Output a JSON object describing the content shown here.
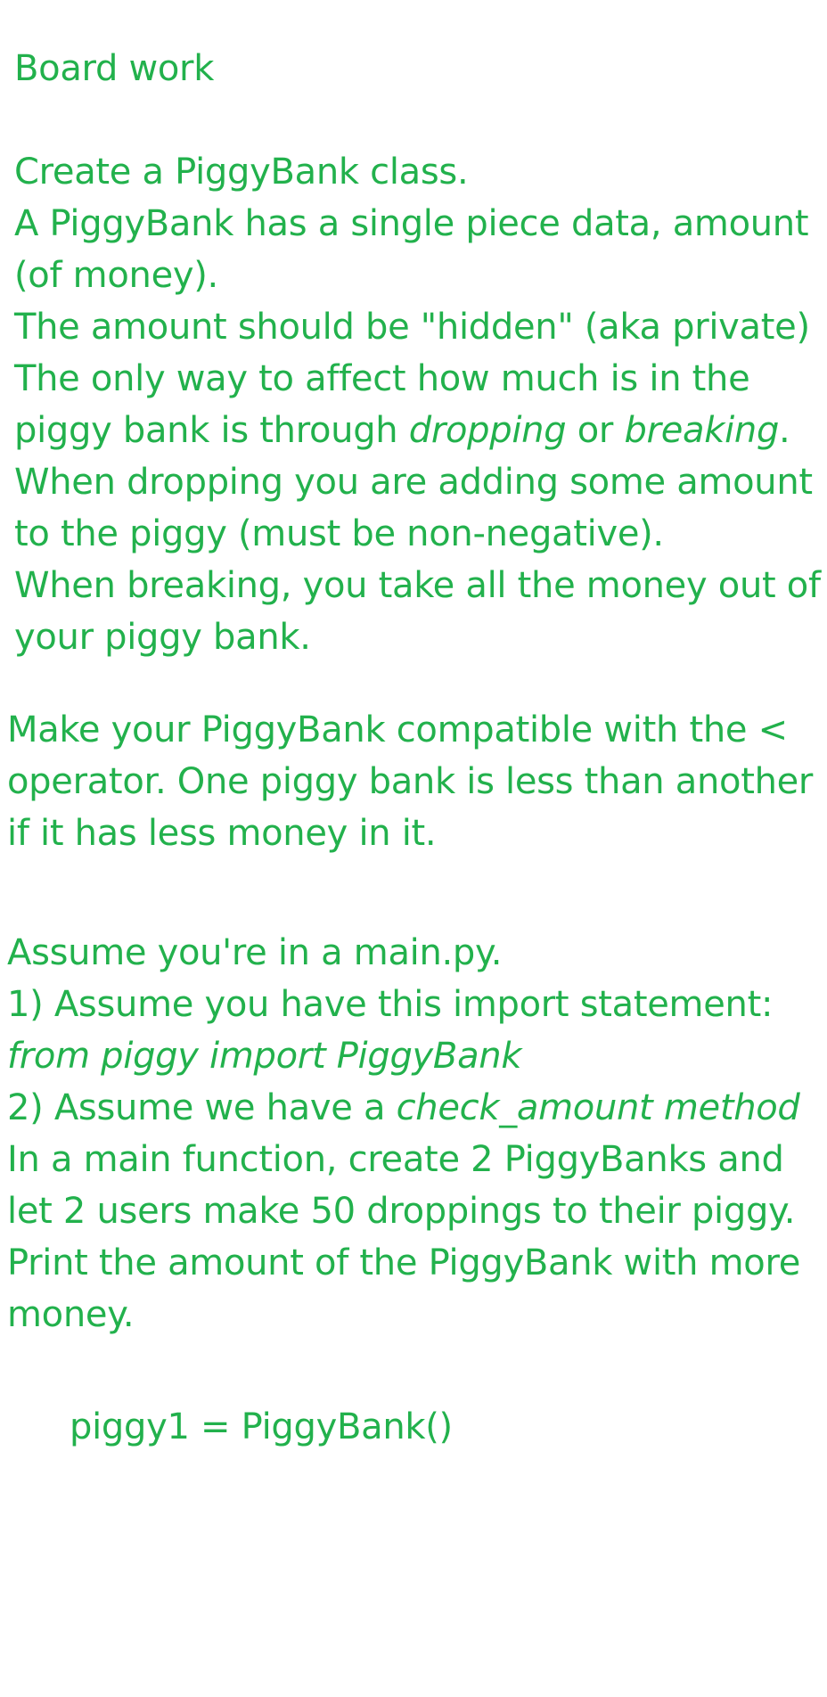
{
  "colors": {
    "text": "#22b14c",
    "background": "#ffffff"
  },
  "section1": {
    "title": "Board work",
    "l1": "Create a PiggyBank class.",
    "l2": "A PiggyBank has a single piece data, amount",
    "l3": "(of money).",
    "l4": "The amount should be \"hidden\" (aka private)",
    "l5": "The only way to affect how much is in the",
    "l6_pre": "piggy bank is through ",
    "l6_em1": "dropping",
    "l6_mid": " or ",
    "l6_em2": "breaking",
    "l6_post": ".",
    "l7": "When dropping you are adding some amount",
    "l8": "to the piggy (must be non-negative).",
    "l9": "When breaking, you take all the money out of",
    "l10": "your piggy bank."
  },
  "section2": {
    "l1": "Make your PiggyBank compatible with the <",
    "l2": "operator. One piggy bank is less than another",
    "l3": "if it has less money in it."
  },
  "section3": {
    "l1": "Assume you're in a main.py.",
    "l2": "1) Assume you have this import statement:",
    "l3": "from piggy import PiggyBank",
    "l4_pre": "2) Assume we have a ",
    "l4_em": "check_amount method",
    "l5": "In a main function, create 2 PiggyBanks and",
    "l6": "let 2 users make 50 droppings to their piggy.",
    "l7": "Print the amount of the PiggyBank with more",
    "l8": "money."
  },
  "code": {
    "l1": "piggy1 = PiggyBank()"
  }
}
